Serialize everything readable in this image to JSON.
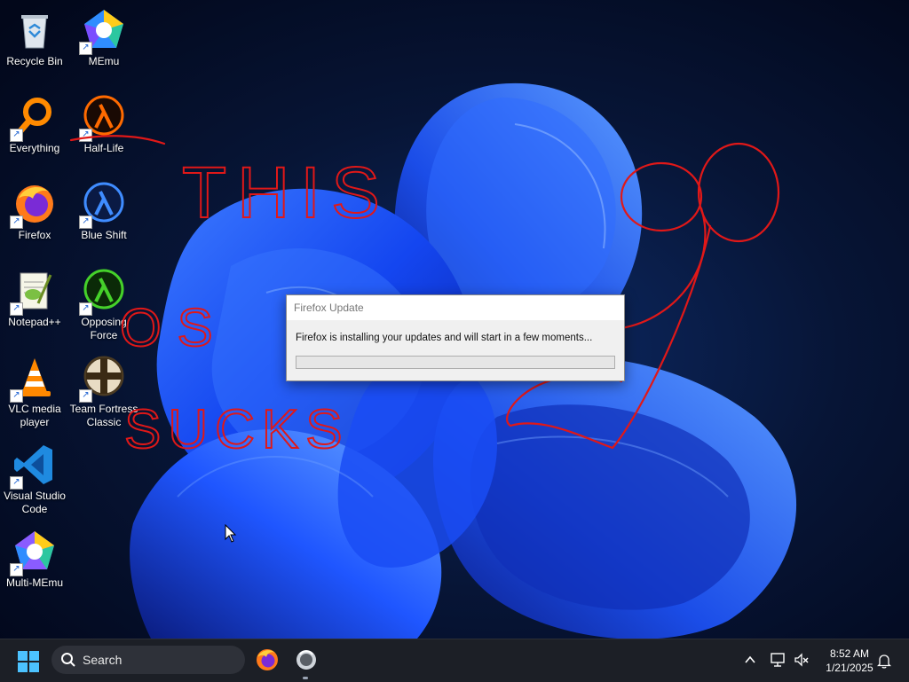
{
  "desktop": {
    "icons": [
      {
        "label": "Recycle Bin",
        "icon": "recycle-bin-icon"
      },
      {
        "label": "MEmu",
        "icon": "memu-icon"
      },
      {
        "label": "Everything",
        "icon": "everything-search-icon"
      },
      {
        "label": "Half-Life",
        "icon": "half-life-lambda-icon"
      },
      {
        "label": "Firefox",
        "icon": "firefox-icon"
      },
      {
        "label": "Blue Shift",
        "icon": "blue-shift-lambda-icon"
      },
      {
        "label": "Notepad++",
        "icon": "notepad-plus-plus-icon"
      },
      {
        "label": "Opposing Force",
        "icon": "opposing-force-lambda-icon"
      },
      {
        "label": "VLC media player",
        "icon": "vlc-cone-icon"
      },
      {
        "label": "Team Fortress Classic",
        "icon": "team-fortress-classic-icon"
      },
      {
        "label": "Visual Studio Code",
        "icon": "vscode-icon"
      },
      {
        "label": "Multi-MEmu",
        "icon": "multi-memu-icon"
      }
    ],
    "shortcut_glyph": "↗",
    "scribble_text": [
      "THIS",
      "OS",
      "SUCKS"
    ]
  },
  "dialog": {
    "title": "Firefox Update",
    "message": "Firefox is installing your updates and will start in a few moments...",
    "progress": 0
  },
  "taskbar": {
    "search_label": "Search",
    "apps": [
      "firefox-icon",
      "firefox-updater-icon"
    ],
    "tray_icons": [
      "chevron-up-icon",
      "network-icon",
      "volume-muted-icon"
    ],
    "time": "8:52 AM",
    "date": "1/21/2025",
    "notification_icon": "bell-icon"
  },
  "colors": {
    "wallpaper_dark": "#030b1e",
    "wallpaper_blue": "#1746ff",
    "scribble_red": "#e01818",
    "taskbar_bg": "#1c1f26",
    "progress_green": "#06b025"
  }
}
